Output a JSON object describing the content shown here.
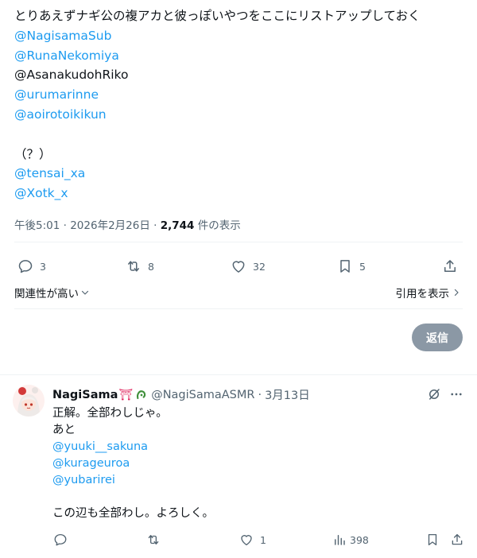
{
  "tweet": {
    "lines": [
      {
        "text": "とりあえずナギ公の複アカと彼っぽいやつをここにリストアップしておく",
        "link": false
      },
      {
        "text": "@NagisamaSub",
        "link": true
      },
      {
        "text": "@RunaNekomiya",
        "link": true
      },
      {
        "text": "@AsanakudohRiko",
        "link": false
      },
      {
        "text": "@urumarinne",
        "link": true
      },
      {
        "text": "@aoirotoikikun",
        "link": true
      },
      {
        "text": "",
        "link": false
      },
      {
        "text": "（？）",
        "link": false
      },
      {
        "text": "@tensai_xa",
        "link": true
      },
      {
        "text": "@Xotk_x",
        "link": true
      }
    ],
    "time": "午後5:01",
    "separator": "·",
    "date": "2026年2月26日",
    "views_count": "2,744",
    "views_label": "件の表示",
    "stats": {
      "replies": "3",
      "reposts": "8",
      "likes": "32",
      "bookmarks": "5"
    },
    "sort_label": "関連性が高い",
    "quote_label": "引用を表示",
    "reply_button": "返信"
  },
  "reply": {
    "name": "NagiSama",
    "name_emojis": "⛩",
    "handle": "@NagiSamaASMR",
    "separator": "·",
    "date": "3月13日",
    "lines": [
      {
        "text": "正解。全部わしじゃ。",
        "link": false
      },
      {
        "text": "あと",
        "link": false
      },
      {
        "text": "@yuuki__sakuna",
        "link": true
      },
      {
        "text": "@kurageuroa",
        "link": true
      },
      {
        "text": "@yubarirei",
        "link": true
      },
      {
        "text": "",
        "link": false
      },
      {
        "text": "この辺も全部わし。よろしく。",
        "link": false
      }
    ],
    "stats": {
      "replies": "",
      "reposts": "",
      "likes": "1",
      "views": "398"
    }
  },
  "icons": [
    "reply-icon",
    "repost-icon",
    "like-icon",
    "bookmark-icon",
    "share-icon",
    "chevron-down-icon",
    "chevron-right-icon",
    "grok-icon",
    "more-icon",
    "views-icon",
    "torii-icon",
    "badge-icon"
  ]
}
